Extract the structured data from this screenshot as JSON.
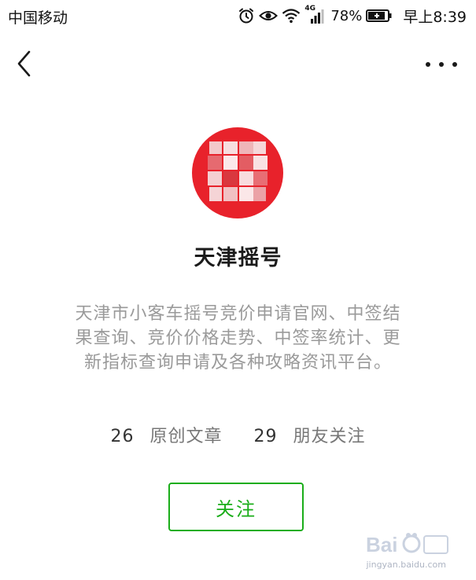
{
  "status_bar": {
    "carrier": "中国移动",
    "network_type": "4G",
    "battery_percent": "78%",
    "time": "早上8:39",
    "icons": [
      "alarm-icon",
      "eye-icon",
      "wifi-icon",
      "signal-icon",
      "battery-icon"
    ]
  },
  "nav": {
    "back_icon": "chevron-left-icon",
    "more_icon": "more-horizontal-icon"
  },
  "profile": {
    "name": "天津摇号",
    "avatar_color": "#e8222b",
    "description": "天津市小客车摇号竞价申请官网、中签结果查询、竞价价格走势、中签率统计、更新指标查询申请及各种攻略资讯平台。"
  },
  "stats": {
    "articles_count": "26",
    "articles_label": "原创文章",
    "friends_count": "29",
    "friends_label": "朋友关注"
  },
  "follow_button": {
    "label": "关注",
    "color": "#1aad19"
  },
  "watermark": {
    "brand": "Baidu 经验",
    "url": "jingyan.baidu.com"
  }
}
